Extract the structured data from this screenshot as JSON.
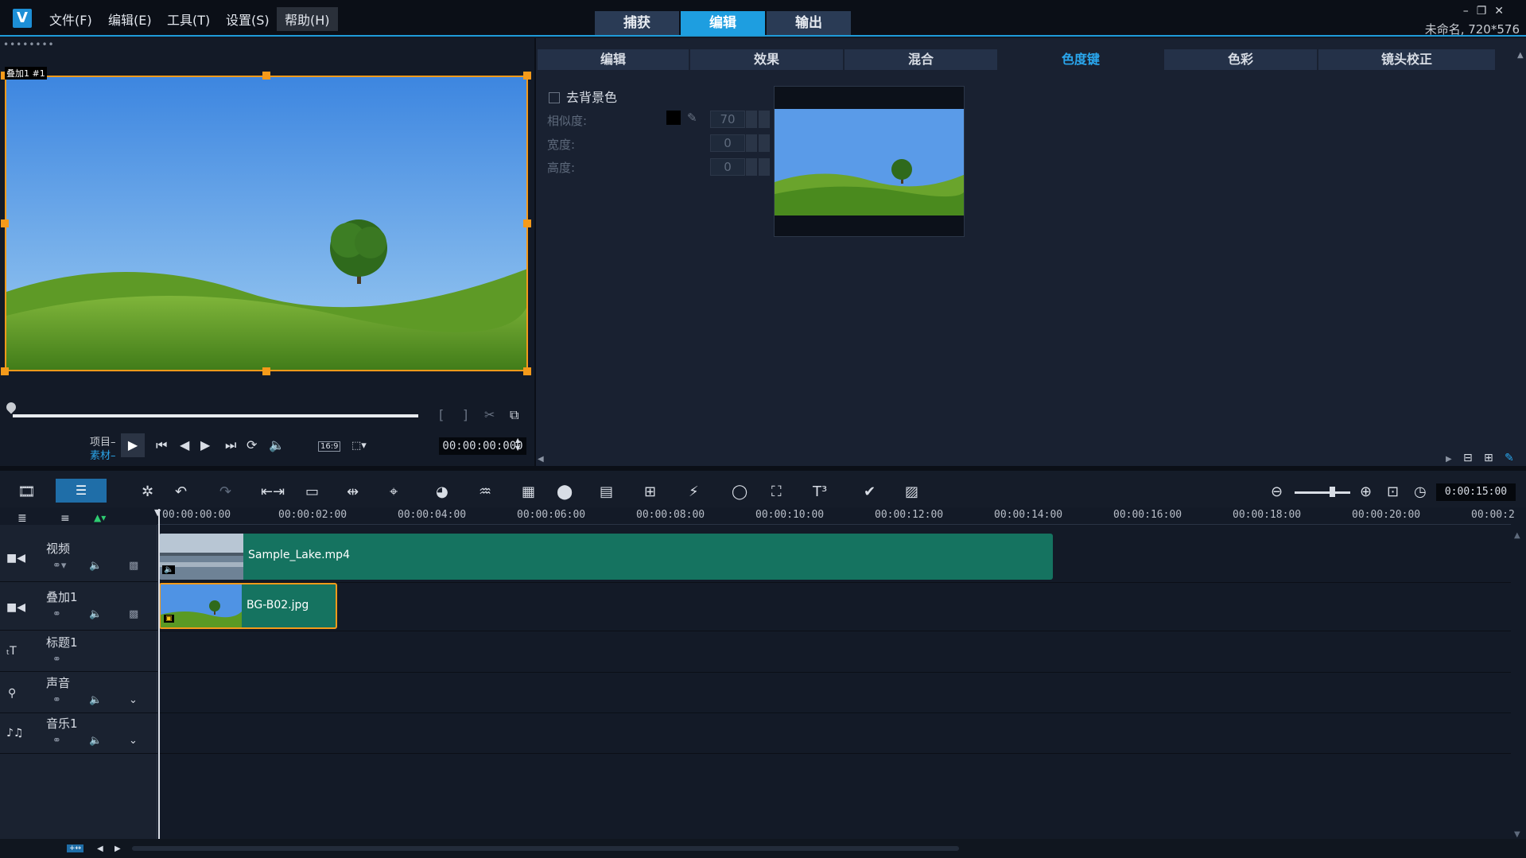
{
  "menu": {
    "file": "文件(F)",
    "edit": "编辑(E)",
    "tools": "工具(T)",
    "settings": "设置(S)",
    "help": "帮助(H)"
  },
  "mode_tabs": [
    "捕获",
    "编辑",
    "输出"
  ],
  "window": {
    "project_info": "未命名, 720*576"
  },
  "preview": {
    "label": "叠加1 #1",
    "mode_project": "项目",
    "mode_clip": "素材",
    "aspect": "16:9",
    "timecode": "00:00:00:000"
  },
  "options": {
    "tabs": [
      "编辑",
      "效果",
      "混合",
      "色度键",
      "色彩",
      "镜头校正"
    ],
    "active_tab": "色度键",
    "remove_bg_label": "去背景色",
    "similarity_label": "相似度:",
    "similarity_value": "70",
    "width_label": "宽度:",
    "width_value": "0",
    "height_label": "高度:",
    "height_value": "0",
    "key_color": "#000000"
  },
  "timeline": {
    "total_timecode": "0:00:15:00",
    "ruler": [
      "00:00:00:00",
      "00:00:02:00",
      "00:00:04:00",
      "00:00:06:00",
      "00:00:08:00",
      "00:00:10:00",
      "00:00:12:00",
      "00:00:14:00",
      "00:00:16:00",
      "00:00:18:00",
      "00:00:20:00",
      "00:00:2"
    ],
    "tracks": [
      {
        "name": "视频",
        "icon": "video-camera-icon"
      },
      {
        "name": "叠加1",
        "icon": "overlay-camera-icon"
      },
      {
        "name": "标题1",
        "icon": "title-icon"
      },
      {
        "name": "声音",
        "icon": "microphone-icon"
      },
      {
        "name": "音乐1",
        "icon": "music-icon"
      }
    ],
    "clips": {
      "video": "Sample_Lake.mp4",
      "overlay": "BG-B02.jpg"
    }
  },
  "colors": {
    "accent": "#1e9ee0",
    "selection": "#f59a1a",
    "clip": "#157360",
    "background": "#131a27"
  }
}
